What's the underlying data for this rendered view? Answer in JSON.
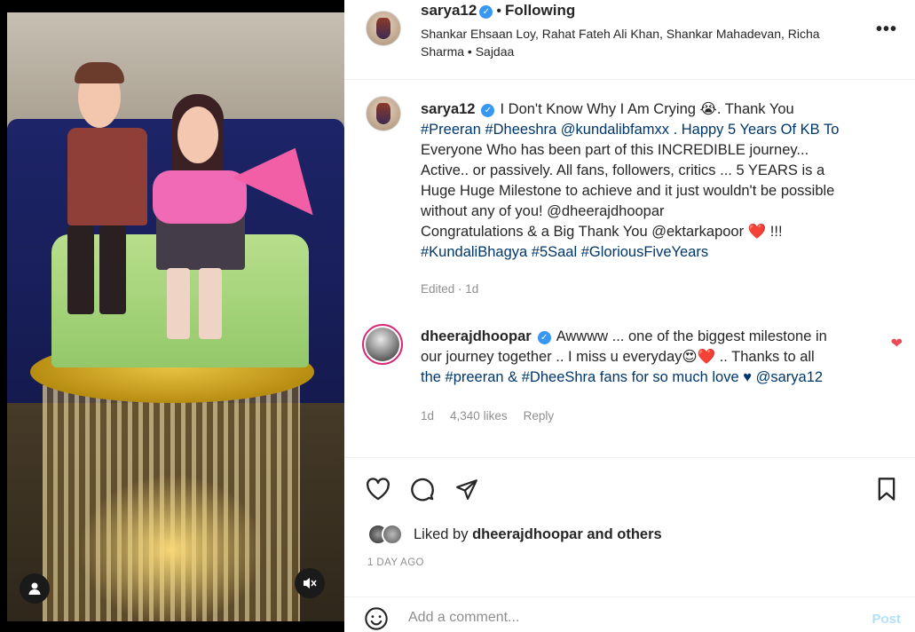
{
  "post": {
    "author": "sarya12",
    "follow_state": "Following",
    "separator": "•",
    "subtitle": "Shankar Ehsaan Loy, Rahat Fateh Ali Khan, Shankar Mahadevan, Richa Sharma • Sajdaa",
    "more": "•••"
  },
  "caption": {
    "username": "sarya12",
    "lines": [
      "I Don't Know Why I Am Crying 😭. Thank You",
      "#Preeran #Dheeshra @kundalibfamxx . Happy 5 Years Of KB To",
      "Everyone Who has been part of this INCREDIBLE journey...",
      "Active.. or passively. All fans, followers, critics ... 5 YEARS is a",
      "Huge Huge Milestone to achieve and it just wouldn't be possible",
      "without any of you! @dheerajdhoopar",
      "Congratulations & a Big Thank You @ektarkapoor ❤️ !!!",
      "#KundaliBhagya #5Saal #GloriousFiveYears"
    ],
    "meta": "Edited · 1d"
  },
  "comment": {
    "username": "dheerajdhoopar",
    "lines": [
      "Awwww ... one of the biggest milestone in",
      "our journey together .. I miss u everyday😍❤️ .. Thanks to all",
      "the #preeran & #DheeShra fans for so much love ♥ @sarya12"
    ],
    "age": "1d",
    "likes": "4,340 likes",
    "reply": "Reply",
    "liked": true,
    "heart_color": "#ed4956"
  },
  "footer": {
    "liked_by_prefix": "Liked by",
    "liked_by_user": "dheerajdhoopar",
    "liked_by_suffix": "and others",
    "time_ago": "1 DAY AGO",
    "comment_placeholder": "Add a comment...",
    "post_label": "Post"
  },
  "icons": {
    "like": "heart-outline-icon",
    "comment": "comment-bubble-icon",
    "share": "paper-plane-icon",
    "save": "bookmark-icon",
    "emoji": "smiley-icon",
    "user_tags": "user-icon",
    "mute": "speaker-muted-icon"
  },
  "colors": {
    "link": "#00376b",
    "verified": "#3897f0",
    "muted_text": "#8e8e8e",
    "post_disabled": "#b2dffc"
  }
}
